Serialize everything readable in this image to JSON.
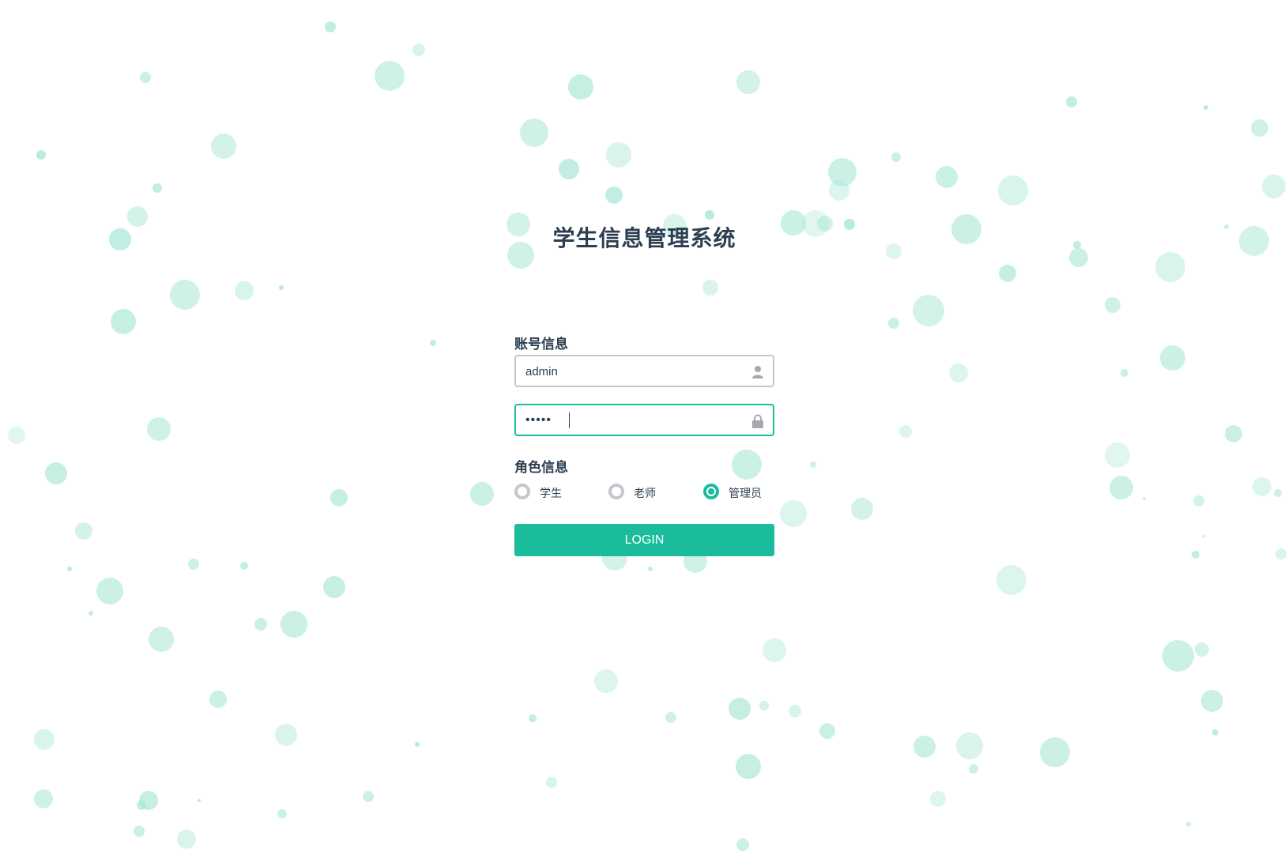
{
  "app": {
    "title": "学生信息管理系统"
  },
  "account": {
    "label": "账号信息",
    "username": "admin",
    "password_masked": "•••••",
    "username_icon": "user-icon",
    "password_icon": "lock-icon"
  },
  "role": {
    "label": "角色信息",
    "options": [
      {
        "label": "学生",
        "checked": false
      },
      {
        "label": "老师",
        "checked": false
      },
      {
        "label": "管理员",
        "checked": true
      }
    ]
  },
  "login_button": {
    "label": "LOGIN"
  },
  "colors": {
    "accent": "#1abc9c",
    "text": "#2c3e50",
    "input_border": "#c4c7cc",
    "icon": "#a6a9ae",
    "bubble": "#a8e6d6"
  }
}
